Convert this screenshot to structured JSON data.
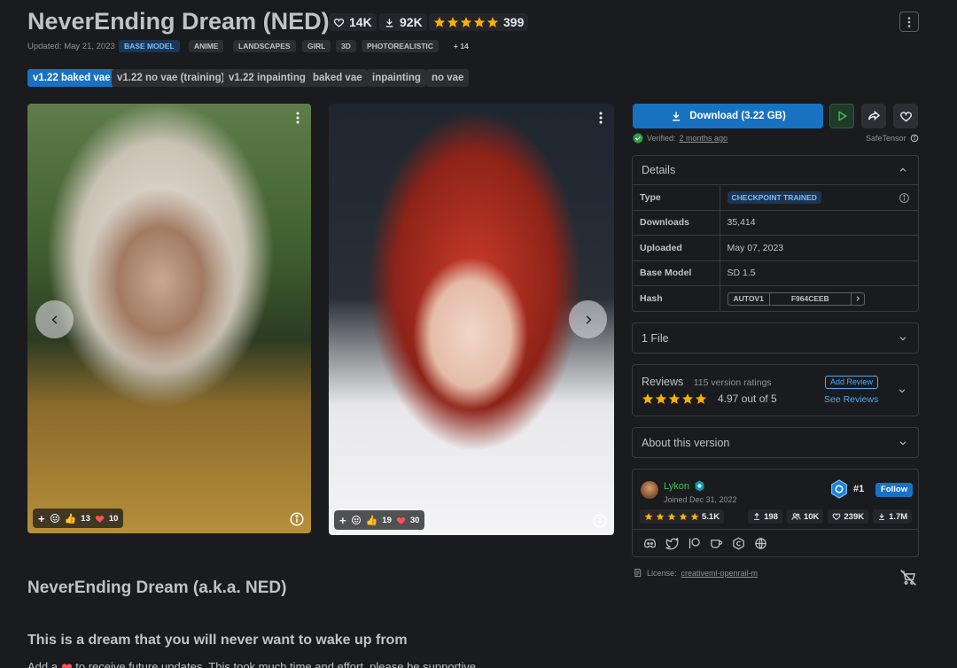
{
  "header": {
    "title": "NeverEnding Dream (NED)",
    "likes": "14K",
    "downloads": "92K",
    "rating_count": "399",
    "updated": "Updated: May 21, 2023",
    "tags": [
      "BASE MODEL",
      "ANIME",
      "LANDSCAPES",
      "GIRL",
      "3D",
      "PHOTOREALISTIC"
    ],
    "more_tags": "+ 14"
  },
  "version_tabs": [
    "v1.22 baked vae",
    "v1.22 no vae (training)",
    "v1.22 inpainting",
    "baked vae",
    "inpainting",
    "no vae"
  ],
  "gallery": {
    "images": [
      {
        "likes": "13",
        "hearts": "10"
      },
      {
        "likes": "19",
        "hearts": "30"
      }
    ]
  },
  "download": {
    "label": "Download (3.22 GB)",
    "verified_prefix": "Verified:",
    "verified_when": "2 months ago",
    "safetensor": "SafeTensor"
  },
  "details": {
    "title": "Details",
    "rows": [
      {
        "key": "Type",
        "value": "CHECKPOINT TRAINED"
      },
      {
        "key": "Downloads",
        "value": "35,414"
      },
      {
        "key": "Uploaded",
        "value": "May 07, 2023"
      },
      {
        "key": "Base Model",
        "value": "SD 1.5"
      },
      {
        "key": "Hash",
        "value": ""
      }
    ],
    "hash_algo": "AUTOV1",
    "hash_value": "F964CEEB"
  },
  "files": {
    "title": "1 File"
  },
  "reviews": {
    "title": "Reviews",
    "count": "115 version ratings",
    "score": "4.97 out of 5",
    "add_label": "Add Review",
    "see_label": "See Reviews"
  },
  "about": {
    "title": "About this version"
  },
  "creator": {
    "name": "Lykon",
    "joined": "Joined Dec 31, 2022",
    "rank": "#1",
    "follow": "Follow",
    "rating": "5.1K",
    "uploads": "198",
    "followers": "10K",
    "likes": "239K",
    "downloads": "1.7M"
  },
  "license": {
    "prefix": "License:",
    "name": "creativeml-openrail-m"
  },
  "description": {
    "heading": "NeverEnding Dream (a.k.a. NED)",
    "subheading": "This is a dream that you will never want to wake up from",
    "line_start": "Add a",
    "line_rest": "to receive future updates. This took much time and effort, please be supportive"
  },
  "colors": {
    "accent": "#1971c2",
    "star": "#fab005",
    "heart": "#fa5252",
    "bg": "#1a1b1e"
  }
}
